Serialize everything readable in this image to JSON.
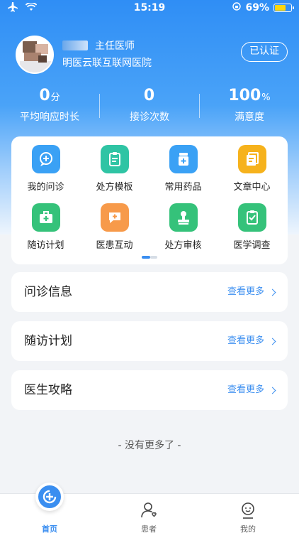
{
  "status_bar": {
    "time": "15:19",
    "battery": "69%",
    "battery_level": 0.69
  },
  "profile": {
    "title": "主任医师",
    "hospital": "明医云联互联网医院",
    "verified_label": "已认证"
  },
  "stats": [
    {
      "value": "0",
      "unit": "分",
      "label": "平均响应时长"
    },
    {
      "value": "0",
      "unit": "",
      "label": "接诊次数"
    },
    {
      "value": "100",
      "unit": "%",
      "label": "满意度"
    }
  ],
  "grid": [
    {
      "label": "我的问诊",
      "icon": "consultation-icon",
      "color": "#3aa1f5"
    },
    {
      "label": "处方模板",
      "icon": "prescription-template-icon",
      "color": "#2fc4a4"
    },
    {
      "label": "常用药品",
      "icon": "medicine-icon",
      "color": "#3aa1f5"
    },
    {
      "label": "文章中心",
      "icon": "article-icon",
      "color": "#f6b21c"
    },
    {
      "label": "随访计划",
      "icon": "followup-kit-icon",
      "color": "#35c27a"
    },
    {
      "label": "医患互动",
      "icon": "interaction-icon",
      "color": "#f79a4a"
    },
    {
      "label": "处方审核",
      "icon": "review-stamp-icon",
      "color": "#35c27a"
    },
    {
      "label": "医学调查",
      "icon": "survey-icon",
      "color": "#35c27a"
    }
  ],
  "sections": [
    {
      "title": "问诊信息",
      "more": "查看更多"
    },
    {
      "title": "随访计划",
      "more": "查看更多"
    },
    {
      "title": "医生攻略",
      "more": "查看更多"
    }
  ],
  "footer_text": "- 没有更多了 -",
  "tabs": [
    {
      "label": "首页",
      "icon": "home-icon",
      "active": true
    },
    {
      "label": "患者",
      "icon": "patient-icon",
      "active": false
    },
    {
      "label": "我的",
      "icon": "profile-icon",
      "active": false
    }
  ],
  "colors": {
    "primary": "#3a8ef0"
  }
}
